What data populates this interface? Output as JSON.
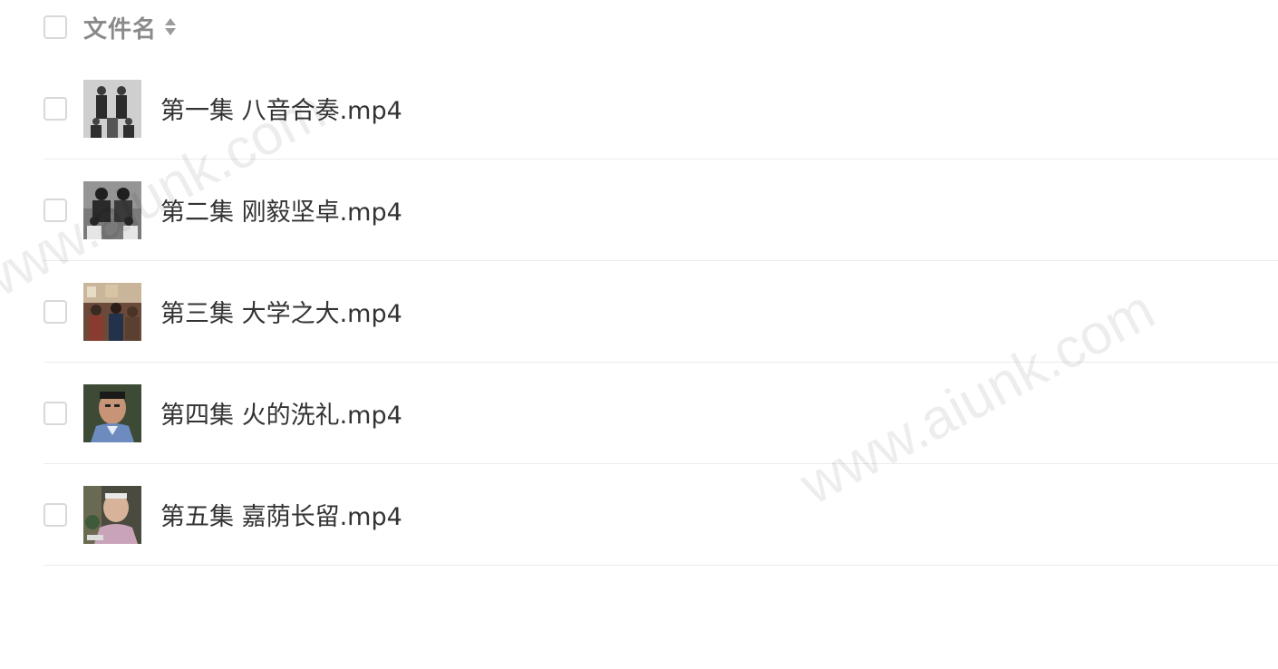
{
  "header": {
    "label": "文件名"
  },
  "files": [
    {
      "name": "第一集 八音合奏.mp4"
    },
    {
      "name": "第二集 刚毅坚卓.mp4"
    },
    {
      "name": "第三集 大学之大.mp4"
    },
    {
      "name": "第四集 火的洗礼.mp4"
    },
    {
      "name": "第五集 嘉荫长留.mp4"
    }
  ],
  "watermark": {
    "text": "www.aiunk.com"
  },
  "colors": {
    "text": "#333333",
    "header_text": "#8a8a8a",
    "divider": "#ececec",
    "checkbox_border": "#d8d8d8"
  }
}
